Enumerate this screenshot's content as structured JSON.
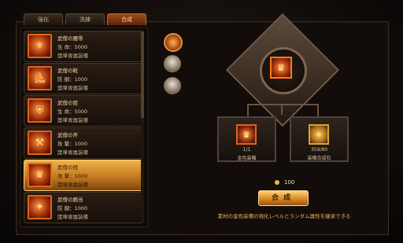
{
  "tabs": [
    {
      "label": "強化",
      "active": false
    },
    {
      "label": "洗練",
      "active": false
    },
    {
      "label": "合成",
      "active": true
    }
  ],
  "items": [
    {
      "name": "武僧の腰帯",
      "stat": "生 命：5000",
      "type": "獎嗱専属装備",
      "icon": "belt-icon",
      "glyph": "⚜"
    },
    {
      "name": "武僧の靴",
      "stat": "防 御：1000",
      "type": "獎嗱専属装備",
      "icon": "boots-icon",
      "glyph": "⛸"
    },
    {
      "name": "武僧の鎧",
      "stat": "生 命：5000",
      "type": "獎嗱専属装備",
      "icon": "armor-icon",
      "glyph": "⛨"
    },
    {
      "name": "武僧の斧",
      "stat": "攻 撃：1000",
      "type": "獎嗱専属装備",
      "icon": "axe-icon",
      "glyph": "⚒"
    },
    {
      "name": "武僧の冠",
      "stat": "攻 撃：1000",
      "type": "獎嗱専属装備",
      "icon": "helmet-icon",
      "glyph": "♛",
      "selected": true
    },
    {
      "name": "武僧の腕当",
      "stat": "防 御：1000",
      "type": "獎嗱専属装備",
      "icon": "bracer-icon",
      "glyph": "✦"
    }
  ],
  "characters": [
    {
      "icon": "character-avatar-fire",
      "selected": true
    },
    {
      "icon": "character-avatar-white",
      "selected": false
    },
    {
      "icon": "character-avatar-grey",
      "selected": false
    }
  ],
  "synthesis": {
    "result_icon": "result-equipment-icon",
    "material1": {
      "label": "金色装備",
      "count": "1/1",
      "icon": "gold-equipment-icon",
      "glyph": "♛"
    },
    "material2": {
      "label": "装備合成石",
      "count": "359/80",
      "icon": "synthesis-stone-icon",
      "glyph": "✧"
    },
    "cost": "100",
    "button_label": "合成",
    "description": "素材の金色装備の強化レベルとランダム属性を継承できる"
  },
  "colors": {
    "accent": "#e06418",
    "gold": "#e9b84a"
  }
}
